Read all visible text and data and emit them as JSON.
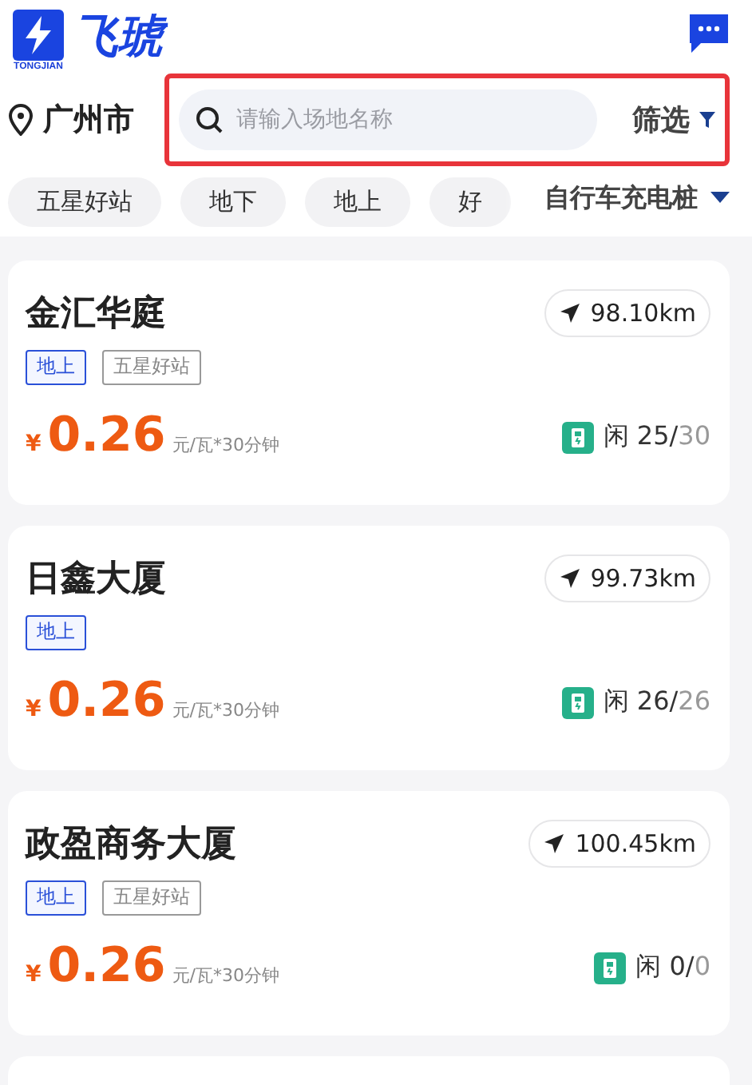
{
  "header": {
    "logo_text": "飞琥",
    "logo_sub": "TONGJIAN"
  },
  "location": {
    "city": "广州市"
  },
  "search": {
    "placeholder": "请输入场地名称",
    "filter": "筛选"
  },
  "chips": [
    {
      "label": "五星好站"
    },
    {
      "label": "地下"
    },
    {
      "label": "地上"
    },
    {
      "label": "好"
    }
  ],
  "category": {
    "label": "自行车充电桩"
  },
  "stations": [
    {
      "name": "金汇华庭",
      "distance": "98.10km",
      "tags": [
        {
          "label": "地上",
          "kind": "level"
        },
        {
          "label": "五星好站",
          "kind": "rating"
        }
      ],
      "currency": "¥",
      "price": "0.26",
      "unit": "元/瓦*30分钟",
      "free_label": "闲",
      "free": "25/",
      "total": "30"
    },
    {
      "name": "日鑫大厦",
      "distance": "99.73km",
      "tags": [
        {
          "label": "地上",
          "kind": "level"
        }
      ],
      "currency": "¥",
      "price": "0.26",
      "unit": "元/瓦*30分钟",
      "free_label": "闲",
      "free": "26/",
      "total": "26"
    },
    {
      "name": "政盈商务大厦",
      "distance": "100.45km",
      "tags": [
        {
          "label": "地上",
          "kind": "level"
        },
        {
          "label": "五星好站",
          "kind": "rating"
        }
      ],
      "currency": "¥",
      "price": "0.26",
      "unit": "元/瓦*30分钟",
      "free_label": "闲",
      "free": "0/",
      "total": "0"
    }
  ]
}
